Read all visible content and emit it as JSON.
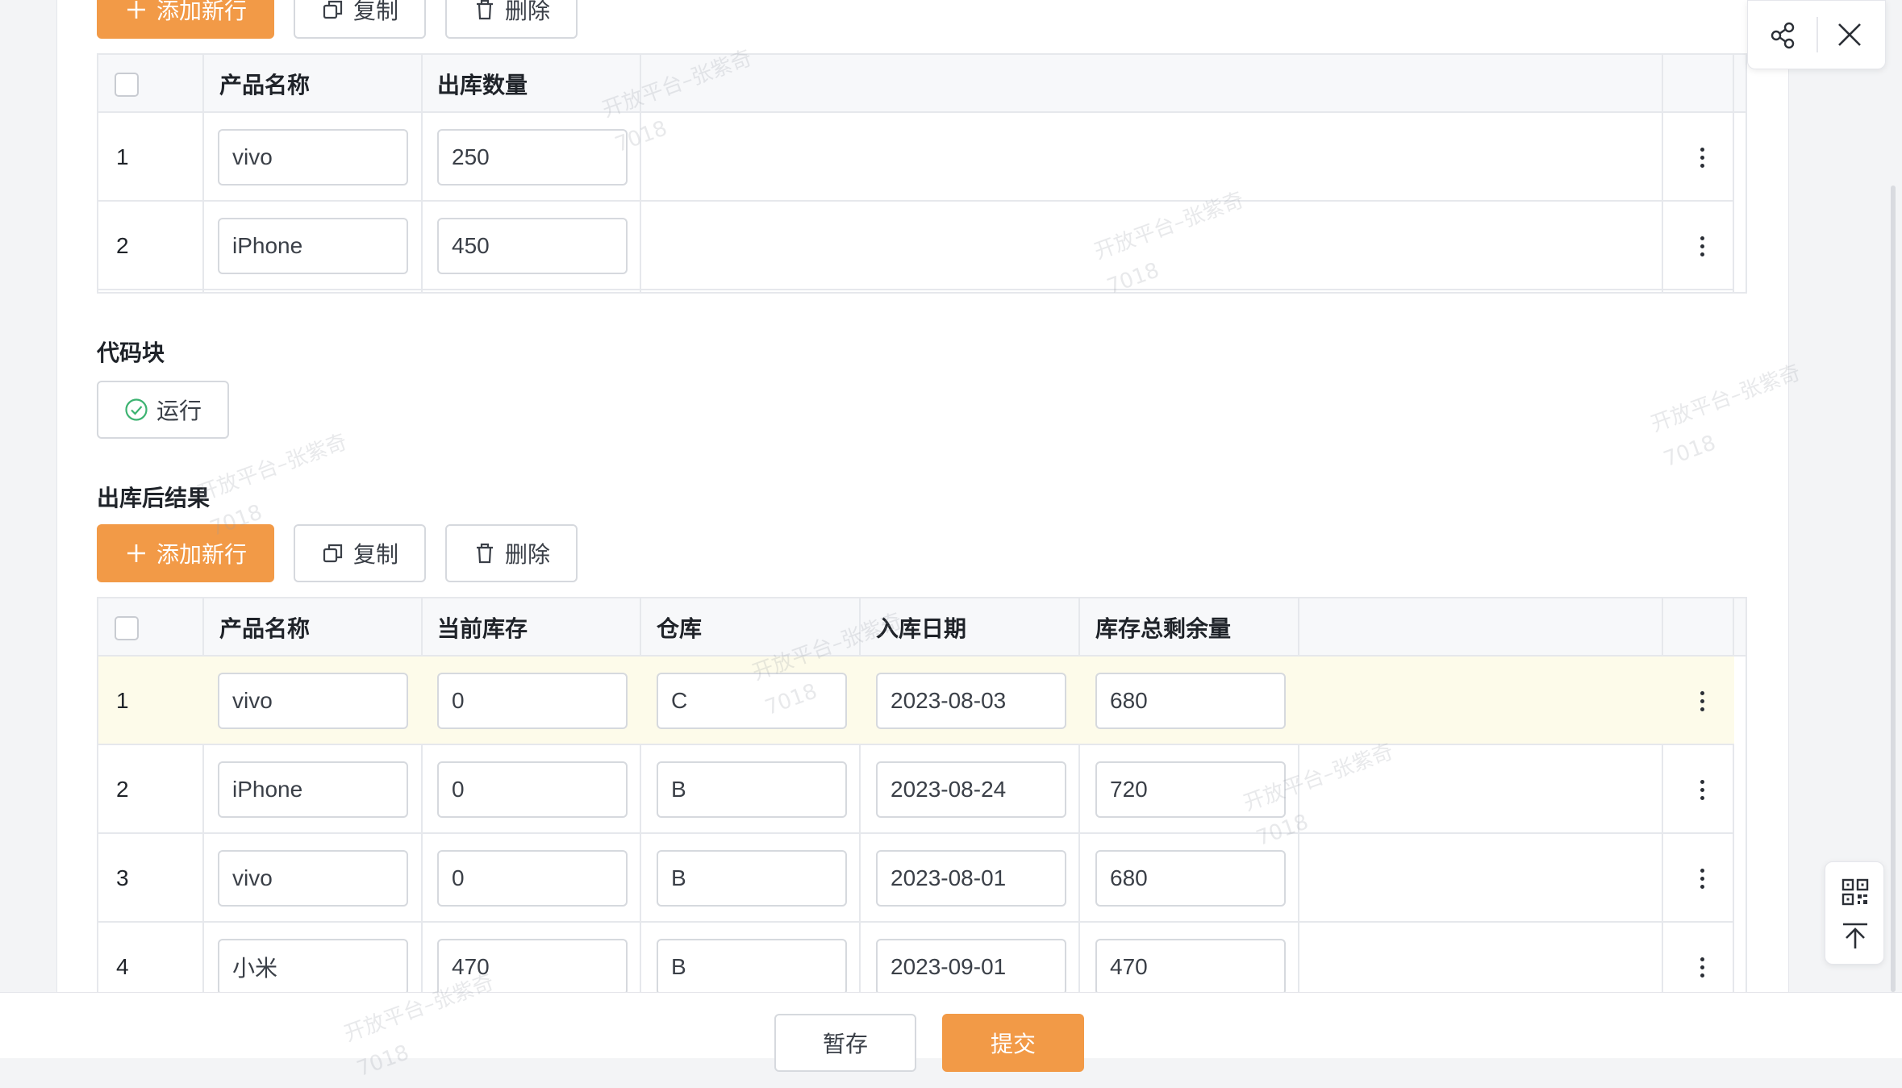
{
  "top_toolbar": {
    "add_label": "添加新行",
    "copy_label": "复制",
    "delete_label": "删除"
  },
  "table1": {
    "headers": [
      "产品名称",
      "出库数量"
    ],
    "rows": [
      {
        "num": "1",
        "product": "vivo",
        "qty": "250"
      },
      {
        "num": "2",
        "product": "iPhone",
        "qty": "450"
      }
    ]
  },
  "code_block": {
    "title": "代码块",
    "run_label": "运行"
  },
  "result": {
    "title": "出库后结果",
    "toolbar": {
      "add_label": "添加新行",
      "copy_label": "复制",
      "delete_label": "删除"
    },
    "headers": [
      "产品名称",
      "当前库存",
      "仓库",
      "入库日期",
      "库存总剩余量"
    ],
    "rows": [
      {
        "num": "1",
        "product": "vivo",
        "stock": "0",
        "warehouse": "C",
        "date": "2023-08-03",
        "remaining": "680"
      },
      {
        "num": "2",
        "product": "iPhone",
        "stock": "0",
        "warehouse": "B",
        "date": "2023-08-24",
        "remaining": "720"
      },
      {
        "num": "3",
        "product": "vivo",
        "stock": "0",
        "warehouse": "B",
        "date": "2023-08-01",
        "remaining": "680"
      },
      {
        "num": "4",
        "product": "小米",
        "stock": "470",
        "warehouse": "B",
        "date": "2023-09-01",
        "remaining": "470"
      }
    ]
  },
  "footer": {
    "save_label": "暂存",
    "submit_label": "提交"
  },
  "watermark": {
    "line1": "开放平台–张紫奇",
    "line2": "7018"
  },
  "colors": {
    "primary": "#f29a47",
    "highlight_row": "#fdfbea",
    "run_icon": "#3cb371"
  }
}
